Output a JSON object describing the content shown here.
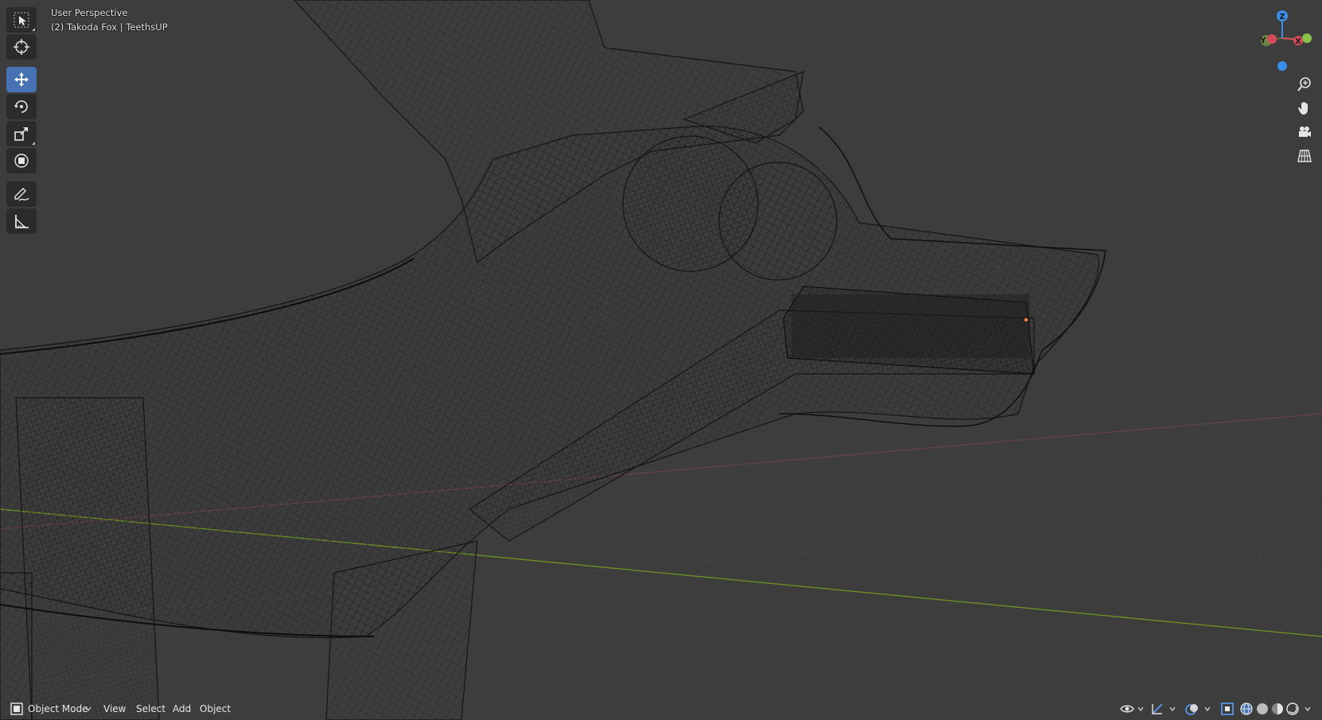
{
  "viewport": {
    "title": "User Perspective",
    "subtitle": "(2) Takoda Fox | TeethsUP"
  },
  "toolbar": {
    "tools": [
      {
        "name": "select-box",
        "icon": "cursor-arrow-icon",
        "active": false
      },
      {
        "name": "cursor",
        "icon": "3d-cursor-icon",
        "active": false
      },
      {
        "name": "move",
        "icon": "move-icon",
        "active": true
      },
      {
        "name": "rotate",
        "icon": "rotate-icon",
        "active": false
      },
      {
        "name": "scale",
        "icon": "scale-icon",
        "active": false
      },
      {
        "name": "transform",
        "icon": "transform-icon",
        "active": false
      },
      {
        "name": "annotate",
        "icon": "pencil-icon",
        "active": false
      },
      {
        "name": "measure",
        "icon": "ruler-icon",
        "active": false
      }
    ]
  },
  "gizmo": {
    "z_label": "Z",
    "y_label": "Y",
    "x_label": "X",
    "colors": {
      "x": "#d64a5d",
      "y": "#8bc34a",
      "z": "#3b8eea"
    }
  },
  "nav_buttons": [
    "zoom-icon",
    "hand-pan-icon",
    "camera-icon",
    "grid-view-icon"
  ],
  "header": {
    "mode_label": "Object Mode",
    "menus": [
      "View",
      "Select",
      "Add",
      "Object"
    ]
  },
  "colors": {
    "background": "#3d3d3d",
    "active_tool": "#4772b3",
    "wireframe": "#111111",
    "axis_x": "#8a4a4a",
    "axis_y": "#6b8e23"
  }
}
